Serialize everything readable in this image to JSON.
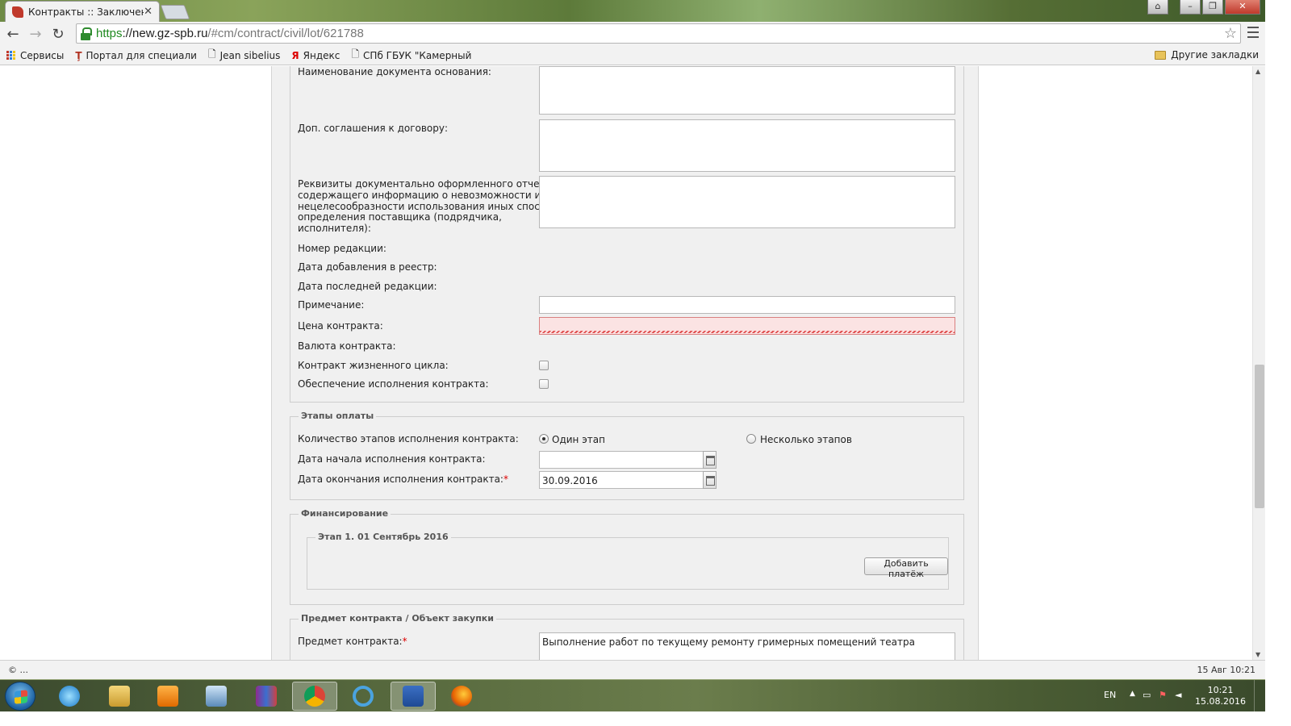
{
  "browser": {
    "tab_title": "Контракты :: Заключение",
    "tab_close": "✕",
    "url_proto": "https",
    "url_host": "://new.gz-spb.ru",
    "url_path": "/#cm/contract/civil/lot/621788",
    "bookmarks": [
      {
        "label": "Сервисы",
        "icon": "apps-icon"
      },
      {
        "label": "Портал для специали",
        "icon": "portal-icon"
      },
      {
        "label": "Jean sibelius",
        "icon": "page-icon"
      },
      {
        "label": "Яндекс",
        "icon": "yandex-icon"
      },
      {
        "label": "СПб ГБУК \"Камерный",
        "icon": "page-icon"
      }
    ],
    "other_bookmarks": "Другие закладки"
  },
  "form": {
    "doc_basis_label": "Наименование документа основания:",
    "supplementary_label": "Доп. соглашения к договору:",
    "report_details_label_lines": [
      "Реквизиты документально оформленного отчета,",
      "содержащего информацию о невозможности или",
      "нецелесообразности использования иных способов",
      "определения поставщика (подрядчика,",
      "исполнителя):"
    ],
    "revision_number_label": "Номер редакции:",
    "registry_date_label": "Дата добавления в реестр:",
    "last_revision_date_label": "Дата последней редакции:",
    "note_label": "Примечание:",
    "price_label": "Цена контракта:",
    "currency_label": "Валюта контракта:",
    "lifecycle_label": "Контракт жизненного цикла:",
    "security_label": "Обеспечение исполнения контракта:"
  },
  "payment_stages": {
    "legend": "Этапы оплаты",
    "count_label": "Количество этапов исполнения контракта:",
    "option_single": "Один этап",
    "option_multiple": "Несколько этапов",
    "selected": "single",
    "start_date_label": "Дата начала исполнения контракта:",
    "start_date_value": "",
    "end_date_label": "Дата окончания исполнения контракта:",
    "end_date_value": "30.09.2016",
    "required_mark": "*"
  },
  "financing": {
    "legend": "Финансирование",
    "stage_legend": "Этап 1. 01 Сентябрь 2016",
    "add_payment_button": "Добавить платёж"
  },
  "subject": {
    "legend": "Предмет контракта / Объект закупки",
    "subject_label": "Предмет контракта:",
    "required_mark": "*",
    "subject_value": "Выполнение работ по текущему ремонту гримерных помещений театра"
  },
  "statusbar": {
    "left": "© ...",
    "right": "15 Авг 10:21"
  },
  "taskbar": {
    "lang": "EN",
    "time": "10:21",
    "date": "15.08.2016",
    "apps": [
      "internet-explorer-icon",
      "file-explorer-icon",
      "media-player-icon",
      "remote-desktop-icon",
      "winrar-icon",
      "chrome-icon",
      "sync-icon",
      "word-icon",
      "firefox-icon"
    ],
    "active_app": "chrome-icon"
  }
}
